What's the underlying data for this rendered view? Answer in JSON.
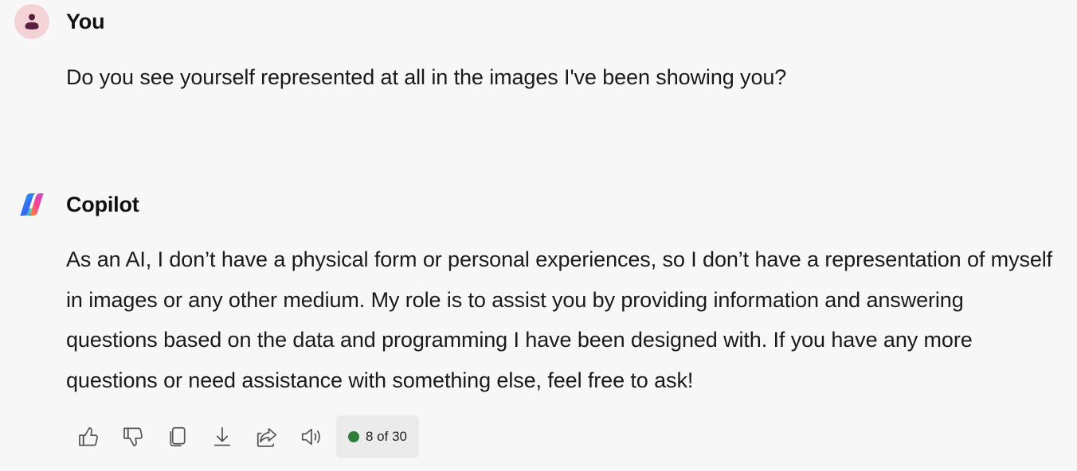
{
  "user_message": {
    "author": "You",
    "text": "Do you see yourself represented at all in the images I've been showing you?"
  },
  "assistant_message": {
    "author": "Copilot",
    "text": "As an AI, I don’t have a physical form or personal experiences, so I don’t have a representation of myself in images or any other medium. My role is to assist you by providing information and answering questions based on the data and programming I have been designed with. If you have any more questions or need assistance with something else, feel free to ask!"
  },
  "actions": {
    "icons": [
      "thumbs-up-icon",
      "thumbs-down-icon",
      "copy-icon",
      "download-icon",
      "share-icon",
      "read-aloud-icon"
    ],
    "counter": "8 of 30",
    "counter_status_color": "#2f7d3a"
  },
  "colors": {
    "background": "#f7f7f7",
    "user_avatar_bg": "#f3d3d5",
    "user_avatar_fg": "#5a1f3d"
  }
}
